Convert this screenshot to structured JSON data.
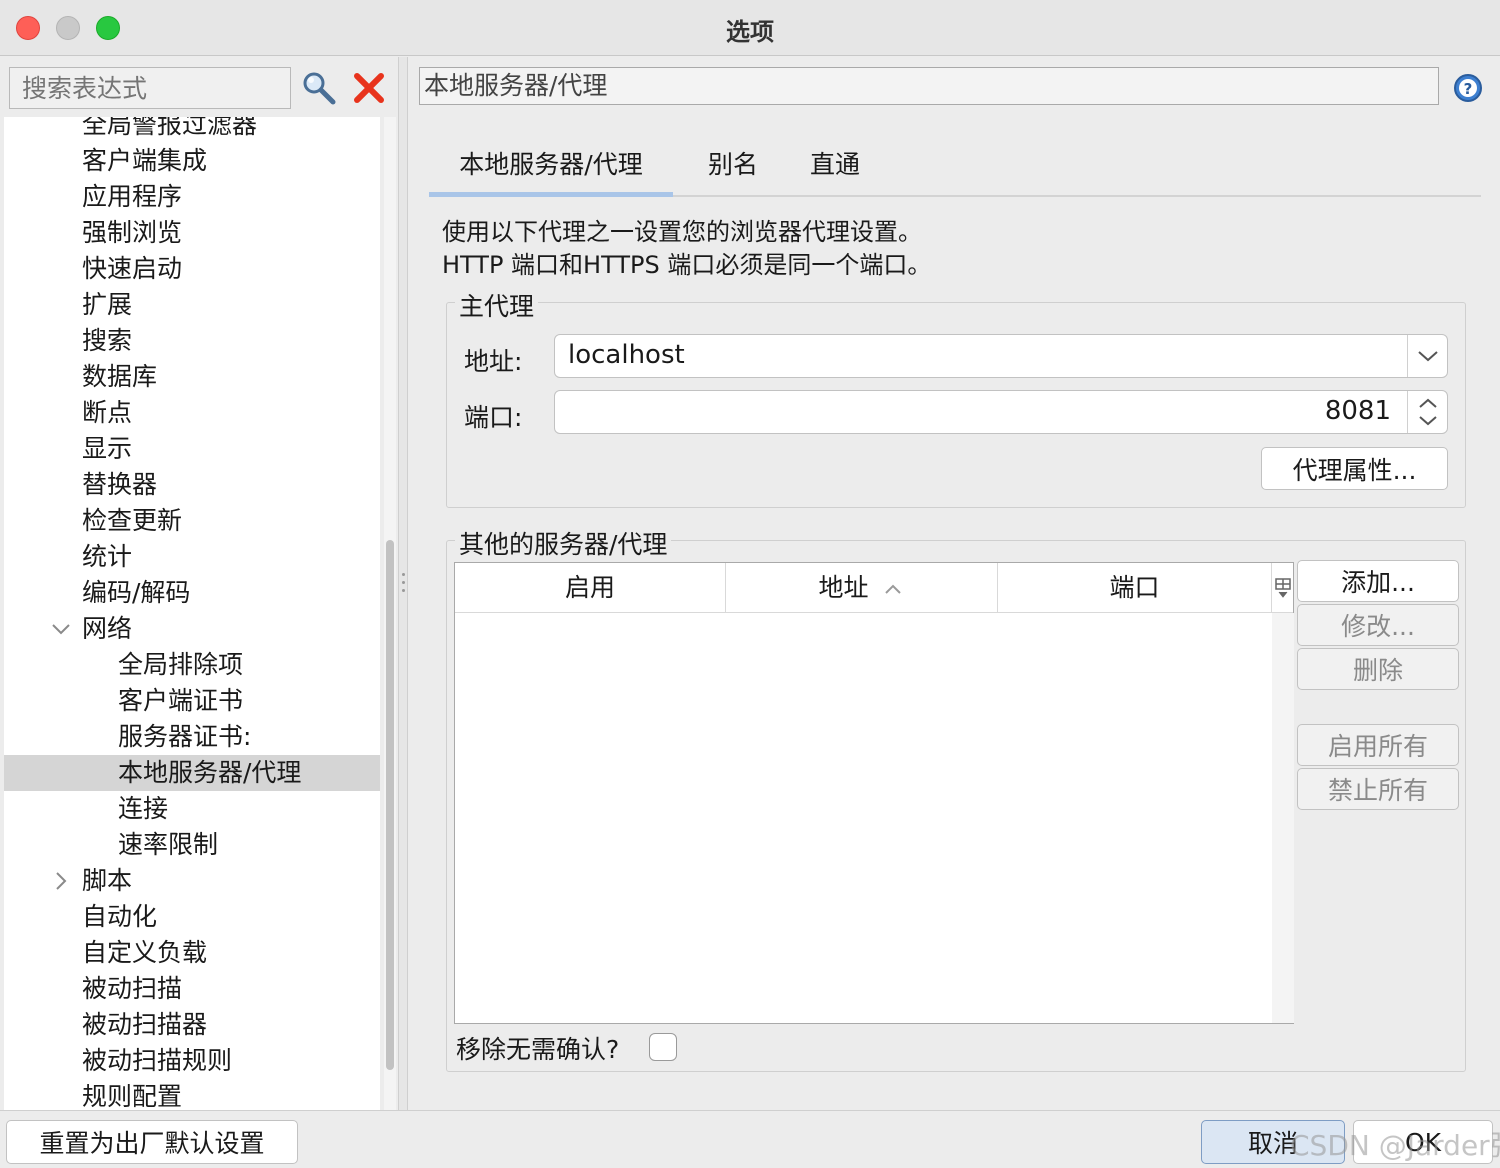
{
  "window": {
    "title": "选项"
  },
  "sidebar": {
    "search_placeholder": "搜索表达式",
    "items": [
      {
        "label": "全局警报过滤器",
        "level": 1
      },
      {
        "label": "客户端集成",
        "level": 1
      },
      {
        "label": "应用程序",
        "level": 1
      },
      {
        "label": "强制浏览",
        "level": 1
      },
      {
        "label": "快速启动",
        "level": 1
      },
      {
        "label": "扩展",
        "level": 1
      },
      {
        "label": "搜索",
        "level": 1
      },
      {
        "label": "数据库",
        "level": 1
      },
      {
        "label": "断点",
        "level": 1
      },
      {
        "label": "显示",
        "level": 1
      },
      {
        "label": "替换器",
        "level": 1
      },
      {
        "label": "检查更新",
        "level": 1
      },
      {
        "label": "统计",
        "level": 1
      },
      {
        "label": "编码/解码",
        "level": 1
      },
      {
        "label": "网络",
        "level": 1,
        "expanded": true
      },
      {
        "label": "全局排除项",
        "level": 2
      },
      {
        "label": "客户端证书",
        "level": 2
      },
      {
        "label": "服务器证书:",
        "level": 2
      },
      {
        "label": "本地服务器/代理",
        "level": 2,
        "selected": true
      },
      {
        "label": "连接",
        "level": 2
      },
      {
        "label": "速率限制",
        "level": 2
      },
      {
        "label": "脚本",
        "level": 1,
        "expanded": false
      },
      {
        "label": "自动化",
        "level": 1
      },
      {
        "label": "自定义负载",
        "level": 1
      },
      {
        "label": "被动扫描",
        "level": 1
      },
      {
        "label": "被动扫描器",
        "level": 1
      },
      {
        "label": "被动扫描规则",
        "level": 1
      },
      {
        "label": "规则配置",
        "level": 1
      }
    ]
  },
  "main": {
    "path": "本地服务器/代理",
    "tabs": [
      {
        "label": "本地服务器/代理",
        "active": true
      },
      {
        "label": "别名",
        "active": false
      },
      {
        "label": "直通",
        "active": false
      }
    ],
    "description_line1": "使用以下代理之一设置您的浏览器代理设置。",
    "description_line2": "HTTP 端口和HTTPS 端口必须是同一个端口。",
    "main_proxy": {
      "title": "主代理",
      "address_label": "地址:",
      "address_value": "localhost",
      "port_label": "端口:",
      "port_value": "8081",
      "properties_button": "代理属性..."
    },
    "other_proxies": {
      "title": "其他的服务器/代理",
      "columns": [
        "启用",
        "地址",
        "端口"
      ],
      "rows": [],
      "buttons": {
        "add": "添加...",
        "modify": "修改...",
        "remove": "删除",
        "enable_all": "启用所有",
        "disable_all": "禁止所有"
      },
      "remove_confirm_label": "移除无需确认?",
      "remove_confirm_checked": false
    }
  },
  "footer": {
    "reset_button": "重置为出厂默认设置",
    "cancel_button": "取消",
    "ok_button": "OK",
    "watermark": "CSDN @Jarder张"
  },
  "colors": {
    "close": "#fe5f57",
    "minimize": "#c9c9c9",
    "zoom": "#28c840",
    "tab_accent": "#a9c5e8",
    "selection": "#d5d5d5",
    "clear_icon": "#e8331c"
  }
}
